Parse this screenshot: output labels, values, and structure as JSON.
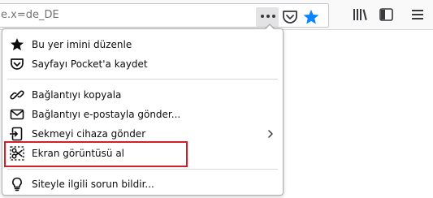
{
  "urlbar": {
    "text": "e.x=de_DE"
  },
  "toolbar": {
    "page_actions_icon": "ellipsis-icon",
    "pocket_icon": "pocket-icon",
    "bookmark_icon": "star-filled-icon",
    "library_icon": "library-icon",
    "sidebar_icon": "sidebar-icon",
    "menu_icon": "hamburger-menu-icon"
  },
  "page_actions_menu": {
    "items": [
      {
        "label": "Bu yer imini düzenle",
        "icon": "star-filled-icon"
      },
      {
        "label": "Sayfayı Pocket'a kaydet",
        "icon": "pocket-icon"
      },
      {
        "label": "Bağlantıyı kopyala",
        "icon": "link-icon"
      },
      {
        "label": "Bağlantıyı e-postayla gönder...",
        "icon": "envelope-icon"
      },
      {
        "label": "Sekmeyi cihaza gönder",
        "icon": "send-to-device-icon",
        "has_submenu": true
      },
      {
        "label": "Ekran görüntüsü al",
        "icon": "screenshot-scissors-icon",
        "highlighted": true
      },
      {
        "label": "Siteyle ilgili sorun bildir...",
        "icon": "lightbulb-icon"
      }
    ]
  },
  "colors": {
    "bookmark_star": "#0a84ff",
    "highlight_box": "#d21f2a",
    "toolbar_bg": "#f9f9fa"
  }
}
